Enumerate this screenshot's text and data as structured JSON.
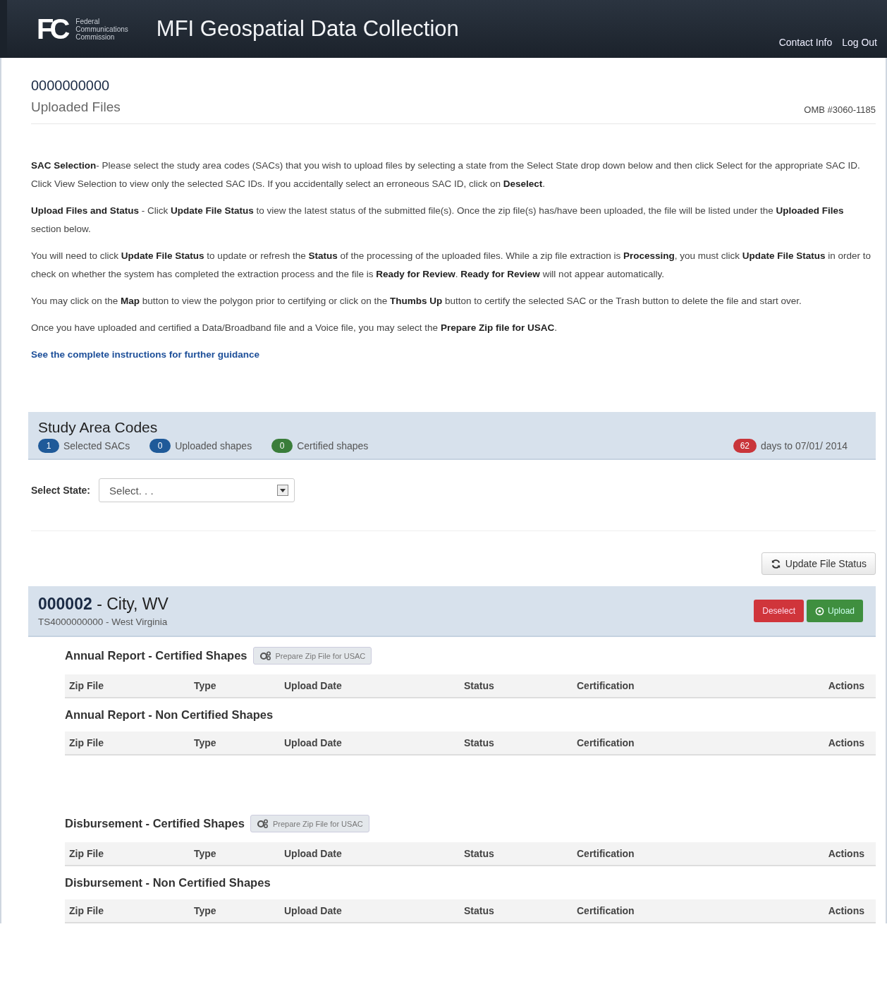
{
  "header": {
    "logo": "FC",
    "agency": [
      "Federal",
      "Communications",
      "Commission"
    ],
    "title": "MFI Geospatial Data Collection",
    "nav": [
      "Contact Info",
      "Log Out"
    ]
  },
  "page": {
    "account": "0000000000",
    "subtitle": "Uploaded Files",
    "omb": "OMB #3060-1185"
  },
  "instructions": [
    "**SAC Selection**- Please select the study area codes (SACs) that you wish to upload files by selecting a state from the Select State drop down below and then click Select for the appropriate SAC ID.  Click View Selection to view only the selected SAC IDs.  If you accidentally select an erroneous SAC ID, click on **Deselect**.",
    "**Upload Files and Status** - Click **Update File Status** to view the latest status of the submitted file(s). Once the zip file(s) has/have been uploaded, the file will be listed under the **Uploaded Files** section below.",
    "You will need to click **Update File Status** to update or refresh the **Status** of the processing of the uploaded files.  While a zip file extraction is **Processing**, you must click **Update File Status** in order to check on whether the system has completed the extraction process and the file is **Ready for Review**. **Ready for Review** will not appear automatically.",
    "You may click on the **Map** button to view the polygon prior to certifying or click on the **Thumbs Up** button to certify the selected SAC or the Trash button to delete the file and start over.",
    "Once you have uploaded and certified a Data/Broadband file and a Voice file, you may select the **Prepare Zip file for USAC**."
  ],
  "guidance_link": "See the complete instructions for further guidance",
  "sac_panel": {
    "title": "Study Area Codes",
    "badges": [
      {
        "count": "1",
        "label": "Selected SACs",
        "color": "#1f5a99"
      },
      {
        "count": "0",
        "label": "Uploaded shapes",
        "color": "#1f5a99"
      },
      {
        "count": "0",
        "label": "Certified shapes",
        "color": "#3a7d3a"
      }
    ],
    "deadline": {
      "count": "62",
      "text": "days to 07/01/ 2014",
      "color": "#c9353a"
    }
  },
  "select_state": {
    "label": "Select State:",
    "placeholder": "Select. . ."
  },
  "update_button": "Update File Status",
  "sac": {
    "code": "000002",
    "name": " - City, WV",
    "subtitle": "TS4000000000 - West Virginia",
    "buttons": [
      {
        "label": "Deselect",
        "kind": "danger"
      },
      {
        "label": "Upload",
        "kind": "success"
      }
    ]
  },
  "sections": [
    {
      "title": "Annual Report - Certified Shapes",
      "prepare_button": "Prepare Zip File for USAC",
      "columns": [
        "Zip File",
        "Type",
        "Upload Date",
        "Status",
        "Certification",
        "Actions"
      ]
    },
    {
      "title": "Annual Report - Non Certified Shapes",
      "columns": [
        "Zip File",
        "Type",
        "Upload Date",
        "Status",
        "Certification",
        "Actions"
      ]
    },
    {
      "title": "Disbursement - Certified Shapes",
      "prepare_button": "Prepare Zip File for USAC",
      "columns": [
        "Zip File",
        "Type",
        "Upload Date",
        "Status",
        "Certification",
        "Actions"
      ]
    },
    {
      "title": "Disbursement - Non Certified Shapes",
      "columns": [
        "Zip File",
        "Type",
        "Upload Date",
        "Status",
        "Certification",
        "Actions"
      ]
    }
  ]
}
